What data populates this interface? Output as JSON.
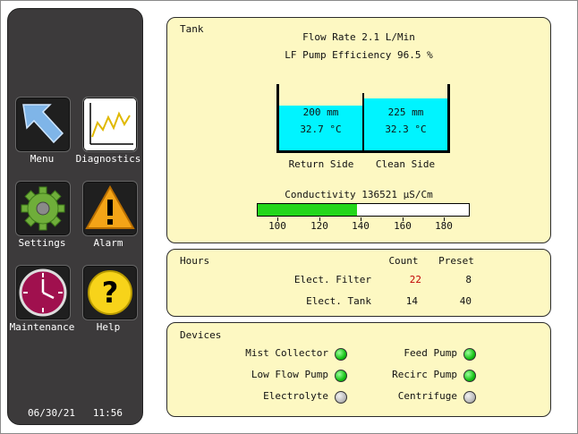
{
  "sidebar": {
    "nav": [
      {
        "label": "Menu",
        "icon": "arrow-up-left-icon"
      },
      {
        "label": "Diagnostics",
        "icon": "line-chart-icon"
      },
      {
        "label": "Settings",
        "icon": "gear-icon"
      },
      {
        "label": "Alarm",
        "icon": "warning-triangle-icon"
      },
      {
        "label": "Maintenance",
        "icon": "clock-icon"
      },
      {
        "label": "Help",
        "icon": "question-icon"
      }
    ],
    "date": "06/30/21",
    "time": "11:56"
  },
  "tank": {
    "title": "Tank",
    "flow_rate": "Flow Rate 2.1 L/Min",
    "pump_efficiency": "LF Pump Efficiency  96.5 %",
    "return_side": {
      "level": "200 mm",
      "temp": "32.7 °C",
      "label": "Return Side",
      "fill_fraction": 0.68
    },
    "clean_side": {
      "level": "225 mm",
      "temp": "32.3 °C",
      "label": "Clean Side",
      "fill_fraction": 0.78
    },
    "conductivity_label": "Conductivity  136521 µS/Cm",
    "conductivity_value": 136521,
    "bar_fill_fraction": 0.47,
    "scale": [
      "100",
      "120",
      "140",
      "160",
      "180"
    ],
    "colors": {
      "water": "#00f4ff",
      "bar": "#23d61b",
      "panel": "#fdf8c2"
    }
  },
  "hours": {
    "title": "Hours",
    "col_count": "Count",
    "col_preset": "Preset",
    "rows": [
      {
        "name": "Elect. Filter",
        "count": "22",
        "preset": "8",
        "count_color": "#c00000"
      },
      {
        "name": "Elect. Tank",
        "count": "14",
        "preset": "40",
        "count_color": "#111111"
      }
    ]
  },
  "devices": {
    "title": "Devices",
    "items": [
      {
        "name": "Mist Collector",
        "state": "on"
      },
      {
        "name": "Feed Pump",
        "state": "on"
      },
      {
        "name": "Low Flow Pump",
        "state": "on"
      },
      {
        "name": "Recirc Pump",
        "state": "on"
      },
      {
        "name": "Electrolyte",
        "state": "off"
      },
      {
        "name": "Centrifuge",
        "state": "off"
      }
    ]
  }
}
